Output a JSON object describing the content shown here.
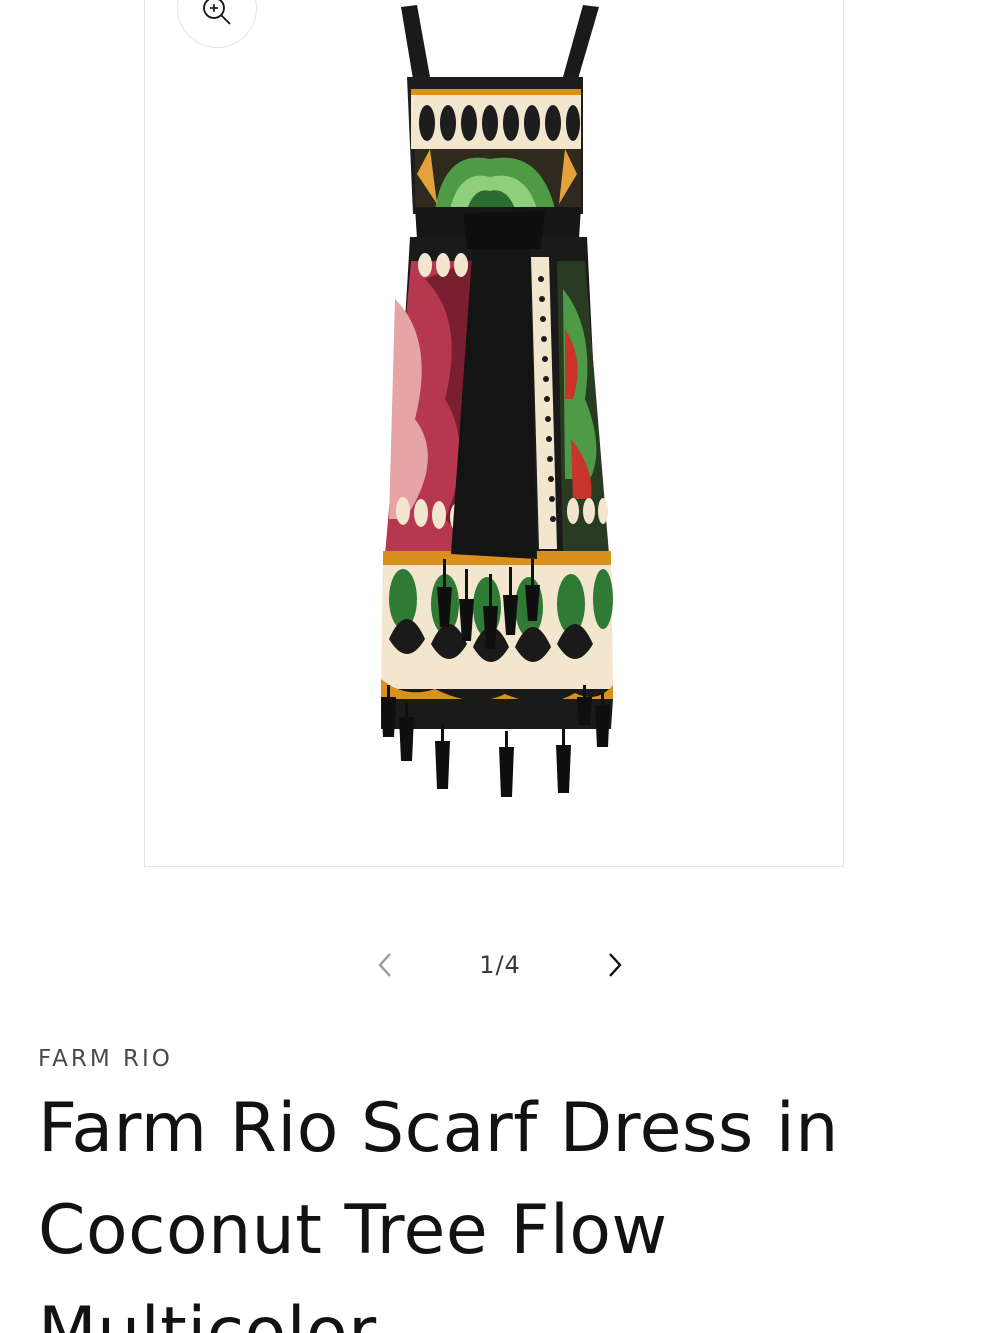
{
  "product_media": {
    "image_alt": "Farm Rio Scarf Dress in Coconut Tree Flow Multicolor",
    "zoom_icon": "zoom-in-icon"
  },
  "slider": {
    "counter": "1/4",
    "prev_icon": "chevron-left-icon",
    "next_icon": "chevron-right-icon"
  },
  "product": {
    "vendor": "FARM RIO",
    "title": "Farm Rio Scarf Dress in Coconut Tree Flow Multicolor"
  },
  "colors": {
    "text": "#121212",
    "muted": "#4a4a4a",
    "border": "#e6e6e6"
  }
}
